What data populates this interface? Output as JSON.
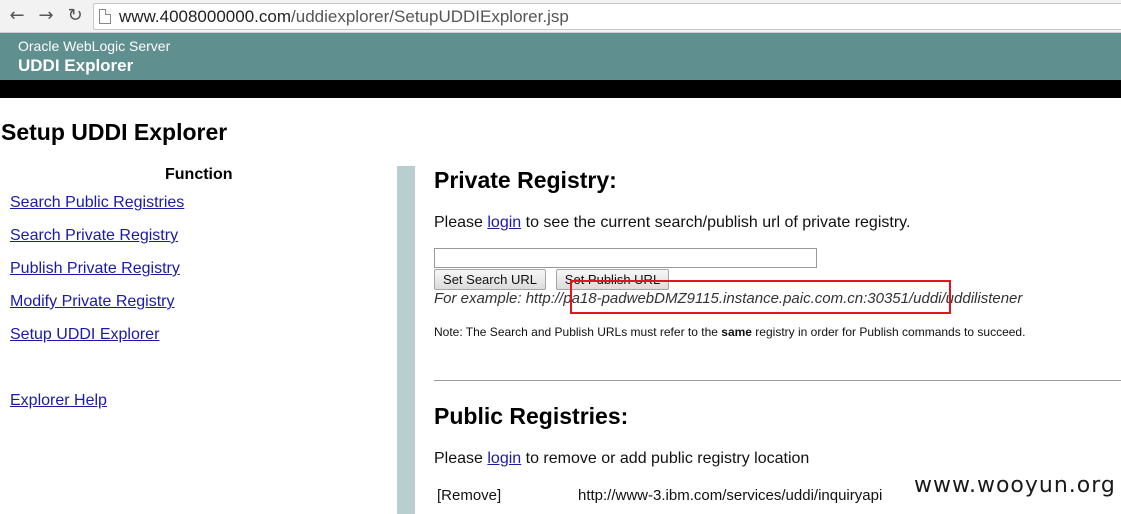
{
  "browser": {
    "url_host": "www.4008000000.com",
    "url_path": "/uddiexplorer/SetupUDDIExplorer.jsp",
    "icons": [
      "back-arrow-icon",
      "forward-arrow-icon",
      "reload-icon",
      "page-icon"
    ]
  },
  "header": {
    "subtitle": "Oracle WebLogic Server",
    "title": "UDDI Explorer",
    "color": "#5f8f8e"
  },
  "page_title": "Setup UDDI Explorer",
  "sidebar": {
    "heading": "Function",
    "items": [
      {
        "label": "Search Public Registries"
      },
      {
        "label": "Search Private Registry"
      },
      {
        "label": "Publish Private Registry"
      },
      {
        "label": "Modify Private Registry"
      },
      {
        "label": "Setup UDDI Explorer"
      }
    ],
    "help": "Explorer Help"
  },
  "private_registry": {
    "heading": "Private Registry:",
    "text_before": "Please ",
    "login_label": "login",
    "text_after": " to see the current search/publish url of private registry.",
    "input_value": "",
    "search_button": "Set Search URL",
    "publish_button": "Set Publish URL",
    "example": "For example: http://pa18-padwebDMZ9115.instance.paic.com.cn:30351/uddi/uddilistener",
    "note_prefix": "Note: The Search and Publish URLs must refer to the ",
    "note_bold": "same",
    "note_suffix": " registry in order for Publish commands to succeed."
  },
  "public_registries": {
    "heading": "Public Registries:",
    "text_before": "Please ",
    "login_label": "login",
    "text_after": " to remove or add public registry location",
    "rows": [
      {
        "remove": "[Remove]",
        "url": "http://www-3.ibm.com/services/uddi/inquiryapi"
      }
    ]
  },
  "watermark": "www.wooyun.org"
}
